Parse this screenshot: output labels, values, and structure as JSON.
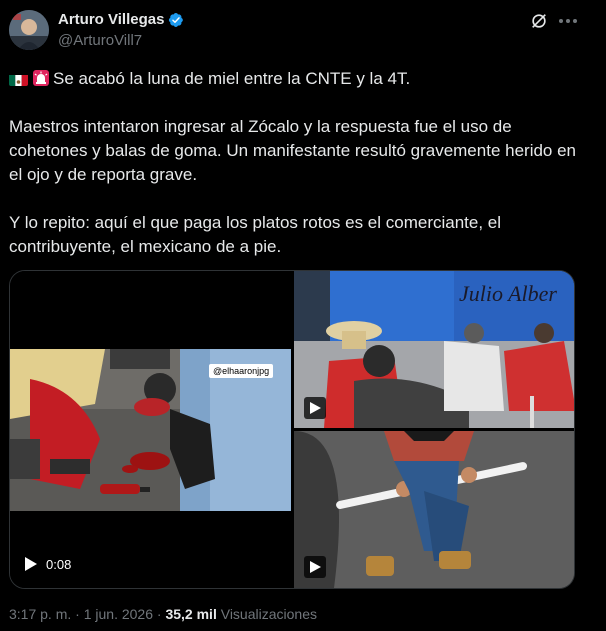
{
  "author": {
    "name": "Arturo Villegas",
    "handle": "@ArturoVill7"
  },
  "post": {
    "line1": "Se acabó la luna de miel entre la CNTE y la 4T.",
    "para2": "Maestros intentaron ingresar al Zócalo y la respuesta fue el uso de cohetones y balas de goma. Un manifestante resultó gravemente herido en el ojo y de reporta grave.",
    "para3": "Y lo repito: aquí el que paga los platos rotos es el comerciante, el contribuyente, el mexicano de a pie.",
    "emoji": [
      "mexico-flag",
      "police-siren"
    ]
  },
  "media": {
    "main_video": {
      "duration": "0:08",
      "watermark": "@elhaaronjpg"
    },
    "wall_graffiti": "Julio Alber"
  },
  "meta": {
    "time": "3:17 p. m.",
    "separator": "·",
    "date": "1 jun. 2026",
    "views_count": "35,2 mil",
    "views_label": "Visualizaciones"
  },
  "colors": {
    "verified": "#1d9bf0",
    "text": "#e7e9ea",
    "muted": "#71767b",
    "border": "#2f3336",
    "background": "#000000"
  }
}
